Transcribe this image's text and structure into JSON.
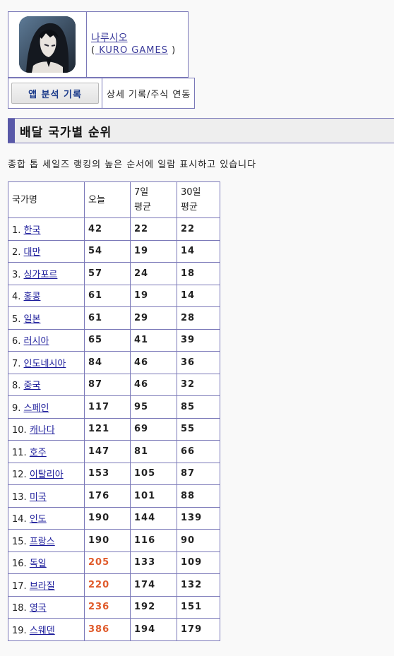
{
  "app": {
    "name": "나루시오",
    "developer": "KURO GAMES",
    "open_paren": "(",
    "close_paren": ")"
  },
  "actions": {
    "app_analysis_button": "앱 분석 기록",
    "detail_link": "상세 기록/주식 연동"
  },
  "section": {
    "title": "배달 국가별 순위",
    "description": "종합 톱 세일즈 랭킹의 높은 순서에 일람 표시하고 있습니다"
  },
  "table": {
    "headers": [
      "국가명",
      "오늘",
      "7일\n평균",
      "30일\n평균"
    ],
    "header_7": "7일",
    "header_7b": "평균",
    "header_30": "30일",
    "header_30b": "평균",
    "rows": [
      {
        "idx": "1.",
        "country": "한국",
        "today": "42",
        "avg7": "22",
        "avg30": "22",
        "hot": false
      },
      {
        "idx": "2.",
        "country": "대만",
        "today": "54",
        "avg7": "19",
        "avg30": "14",
        "hot": false
      },
      {
        "idx": "3.",
        "country": "싱가포르",
        "today": "57",
        "avg7": "24",
        "avg30": "18",
        "hot": false
      },
      {
        "idx": "4.",
        "country": "홍콩",
        "today": "61",
        "avg7": "19",
        "avg30": "14",
        "hot": false
      },
      {
        "idx": "5.",
        "country": "일본",
        "today": "61",
        "avg7": "29",
        "avg30": "28",
        "hot": false
      },
      {
        "idx": "6.",
        "country": "러시아",
        "today": "65",
        "avg7": "41",
        "avg30": "39",
        "hot": false
      },
      {
        "idx": "7.",
        "country": "인도네시아",
        "today": "84",
        "avg7": "46",
        "avg30": "36",
        "hot": false
      },
      {
        "idx": "8.",
        "country": "중국",
        "today": "87",
        "avg7": "46",
        "avg30": "32",
        "hot": false
      },
      {
        "idx": "9.",
        "country": "스페인",
        "today": "117",
        "avg7": "95",
        "avg30": "85",
        "hot": false
      },
      {
        "idx": "10.",
        "country": "캐나다",
        "today": "121",
        "avg7": "69",
        "avg30": "55",
        "hot": false
      },
      {
        "idx": "11.",
        "country": "호주",
        "today": "147",
        "avg7": "81",
        "avg30": "66",
        "hot": false
      },
      {
        "idx": "12.",
        "country": "이탈리아",
        "today": "153",
        "avg7": "105",
        "avg30": "87",
        "hot": false
      },
      {
        "idx": "13.",
        "country": "미국",
        "today": "176",
        "avg7": "101",
        "avg30": "88",
        "hot": false
      },
      {
        "idx": "14.",
        "country": "인도",
        "today": "190",
        "avg7": "144",
        "avg30": "139",
        "hot": false
      },
      {
        "idx": "15.",
        "country": "프랑스",
        "today": "190",
        "avg7": "116",
        "avg30": "90",
        "hot": false
      },
      {
        "idx": "16.",
        "country": "독일",
        "today": "205",
        "avg7": "133",
        "avg30": "109",
        "hot": true
      },
      {
        "idx": "17.",
        "country": "브라질",
        "today": "220",
        "avg7": "174",
        "avg30": "132",
        "hot": true
      },
      {
        "idx": "18.",
        "country": "영국",
        "today": "236",
        "avg7": "192",
        "avg30": "151",
        "hot": true
      },
      {
        "idx": "19.",
        "country": "스웨덴",
        "today": "386",
        "avg7": "194",
        "avg30": "179",
        "hot": true
      }
    ]
  },
  "colors": {
    "accent": "#5959a8",
    "border": "#7a78b8",
    "hot": "#e05a2a"
  }
}
